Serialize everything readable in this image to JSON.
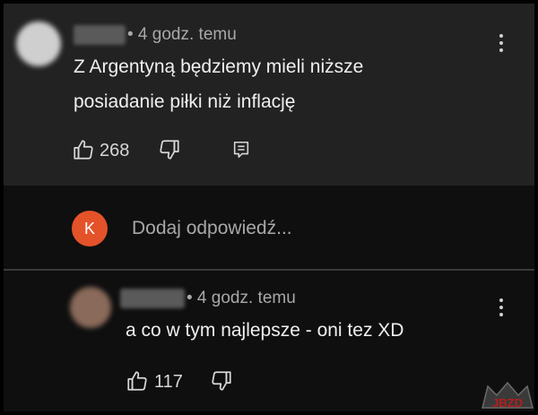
{
  "comment": {
    "time": "• 4 godz. temu",
    "text_line1": "Z Argentyną będziemy mieli niższe",
    "text_line2": "posiadanie piłki niż inflację",
    "likes": "268"
  },
  "reply_box": {
    "user_initial": "K",
    "placeholder": "Dodaj odpowiedź..."
  },
  "reply": {
    "time": "• 4 godz. temu",
    "text": "a co w tym najlepsze - oni tez XD",
    "likes": "117"
  },
  "watermark": "JBZD",
  "colors": {
    "background": "#0f0f0f",
    "comment_background": "#222222",
    "avatar_accent": "#e4522a"
  }
}
